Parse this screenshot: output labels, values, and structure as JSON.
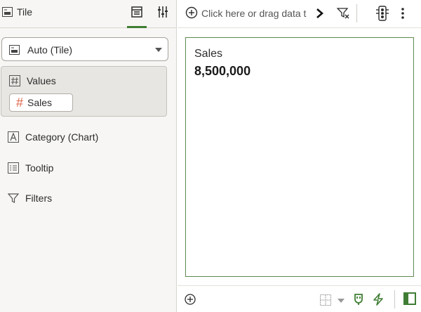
{
  "left_panel": {
    "header": {
      "title": "Tile",
      "icon": "tile-viz-icon"
    },
    "tabs": [
      {
        "name": "grammar",
        "icon": "grammar-icon",
        "selected": true
      },
      {
        "name": "properties",
        "icon": "sliders-icon",
        "selected": false
      }
    ],
    "viz_type": {
      "label": "Auto (Tile)",
      "icon": "tile-viz-icon"
    },
    "drop_targets": {
      "values": {
        "label": "Values",
        "icon": "hash-box-icon",
        "items": [
          {
            "label": "Sales",
            "icon": "hash-icon"
          }
        ]
      },
      "category": {
        "label": "Category (Chart)",
        "icon": "letter-a-box-icon"
      },
      "tooltip": {
        "label": "Tooltip",
        "icon": "list-box-icon"
      },
      "filters": {
        "label": "Filters",
        "icon": "funnel-icon"
      }
    }
  },
  "toolbar": {
    "add_text": "Click here or drag data t",
    "icons": [
      "add-circle-icon",
      "chevron-right-icon",
      "filter-x-icon",
      "traffic-light-icon",
      "more-vertical-icon"
    ]
  },
  "canvas": {
    "tile": {
      "label": "Sales",
      "value": "8,500,000"
    }
  },
  "bottom_bar": {
    "icons": [
      "add-circle-icon",
      "grid-layout-icon",
      "plug-icon",
      "lightning-icon",
      "panel-toggle-icon"
    ]
  },
  "colors": {
    "accent": "#3f7d34",
    "measure_hash": "#e0684c",
    "canvas_border": "#5d8a50"
  }
}
